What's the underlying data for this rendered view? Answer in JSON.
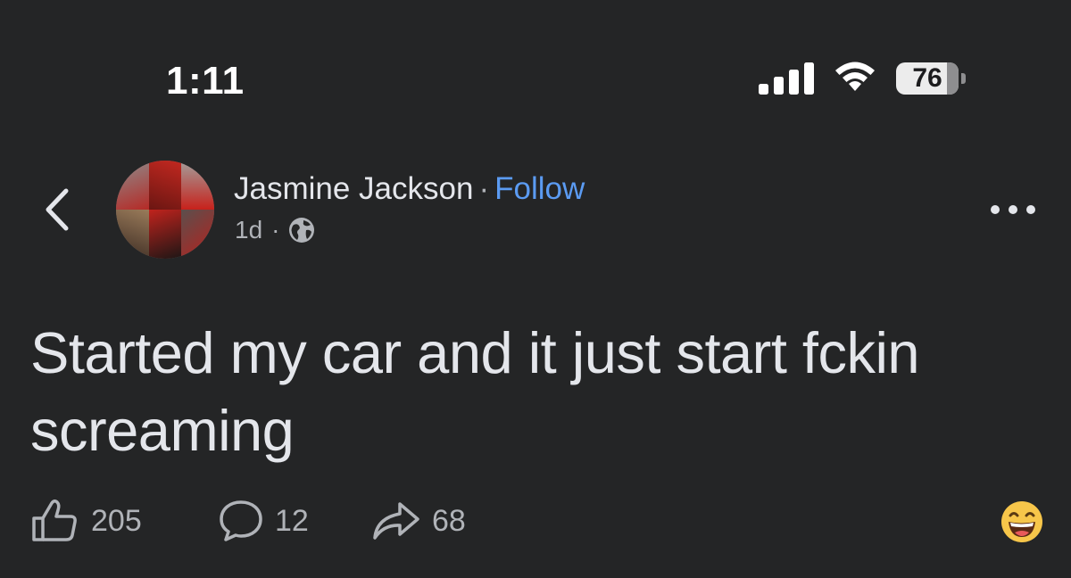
{
  "status_bar": {
    "time": "1:11",
    "battery": "76",
    "icons": [
      "signal-icon",
      "wifi-icon",
      "battery-icon"
    ]
  },
  "header": {
    "back_icon": "chevron-left-icon",
    "author_name": "Jasmine Jackson",
    "separator": "·",
    "follow_label": "Follow",
    "timestamp": "1d",
    "meta_separator": "·",
    "privacy_icon": "globe-icon",
    "more_icon": "more-horizontal-icon"
  },
  "post": {
    "text": "Started my car and it just start fckin screaming"
  },
  "actions": {
    "like_count": "205",
    "comment_count": "12",
    "share_count": "68",
    "like_icon": "thumbs-up-icon",
    "comment_icon": "comment-icon",
    "share_icon": "share-icon",
    "reaction_icon": "grinning-emoji-icon"
  },
  "colors": {
    "background": "#242526",
    "text_primary": "#e4e6eb",
    "text_secondary": "#b0b3b8",
    "accent_link": "#5b9bf2"
  }
}
